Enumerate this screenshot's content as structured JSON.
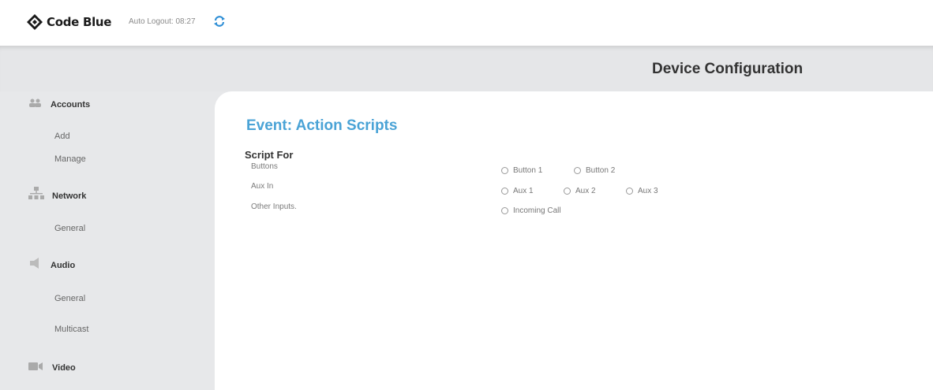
{
  "app": {
    "brand": "Code Blue",
    "auto_logout": "Auto Logout: 08:27",
    "refresh_icon": "refresh-icon"
  },
  "header": {
    "title": "Device Configuration"
  },
  "sidebar": {
    "sections": [
      {
        "label": "Accounts",
        "icon": "users-icon",
        "items": [
          "Add",
          "Manage"
        ]
      },
      {
        "label": "Network",
        "icon": "network-icon",
        "items": [
          "General"
        ]
      },
      {
        "label": "Audio",
        "icon": "speaker-icon",
        "items": [
          "General",
          "Multicast"
        ]
      },
      {
        "label": "Video",
        "icon": "video-icon",
        "items": []
      }
    ]
  },
  "main": {
    "title": "Event: Action Scripts",
    "script_for_label": "Script For",
    "rows": [
      {
        "label": "Buttons",
        "options": [
          "Button 1",
          "Button 2"
        ]
      },
      {
        "label": "Aux In",
        "options": [
          "Aux 1",
          "Aux 2",
          "Aux 3"
        ]
      },
      {
        "label": "Other Inputs.",
        "options": [
          "Incoming Call"
        ]
      }
    ]
  },
  "colors": {
    "accent": "#4aa3d6",
    "background": "#e7e8ea",
    "panel": "#ffffff"
  }
}
